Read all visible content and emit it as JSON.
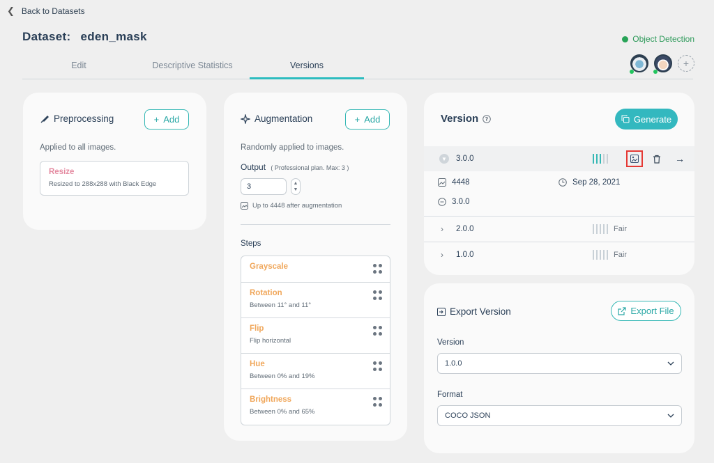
{
  "nav": {
    "back_label": "Back to Datasets"
  },
  "header": {
    "title_label": "Dataset:",
    "dataset_name": "eden_mask",
    "task_type": "Object Detection"
  },
  "tabs": [
    {
      "label": "Edit",
      "active": false
    },
    {
      "label": "Descriptive Statistics",
      "active": false
    },
    {
      "label": "Versions",
      "active": true
    }
  ],
  "preprocessing": {
    "title": "Preprocessing",
    "add_label": "Add",
    "subtitle": "Applied to all images.",
    "items": [
      {
        "name": "Resize",
        "desc": "Resized to 288x288 with Black Edge"
      }
    ]
  },
  "augmentation": {
    "title": "Augmentation",
    "add_label": "Add",
    "subtitle": "Randomly applied to images.",
    "output_label": "Output",
    "output_hint": "( Professional plan. Max: 3 )",
    "output_value": "3",
    "after_note": "Up to 4448 after augmentation",
    "steps_label": "Steps",
    "steps": [
      {
        "name": "Grayscale",
        "desc": ""
      },
      {
        "name": "Rotation",
        "desc": "Between 11° and 11°"
      },
      {
        "name": "Flip",
        "desc": "Flip horizontal"
      },
      {
        "name": "Hue",
        "desc": "Between 0% and 19%"
      },
      {
        "name": "Brightness",
        "desc": "Between 0% and 65%"
      }
    ]
  },
  "version_panel": {
    "title": "Version",
    "generate_label": "Generate",
    "versions": [
      {
        "version": "3.0.0",
        "expanded": true,
        "quality": "",
        "images": "4448",
        "date": "Sep 28, 2021",
        "base": "3.0.0"
      },
      {
        "version": "2.0.0",
        "expanded": false,
        "quality": "Fair"
      },
      {
        "version": "1.0.0",
        "expanded": false,
        "quality": "Fair"
      }
    ]
  },
  "export_panel": {
    "title": "Export Version",
    "export_label": "Export File",
    "version_label": "Version",
    "version_value": "1.0.0",
    "format_label": "Format",
    "format_value": "COCO JSON"
  },
  "colors": {
    "accent": "#36b8b5",
    "highlight": "#e53935",
    "online": "#22c55e"
  }
}
